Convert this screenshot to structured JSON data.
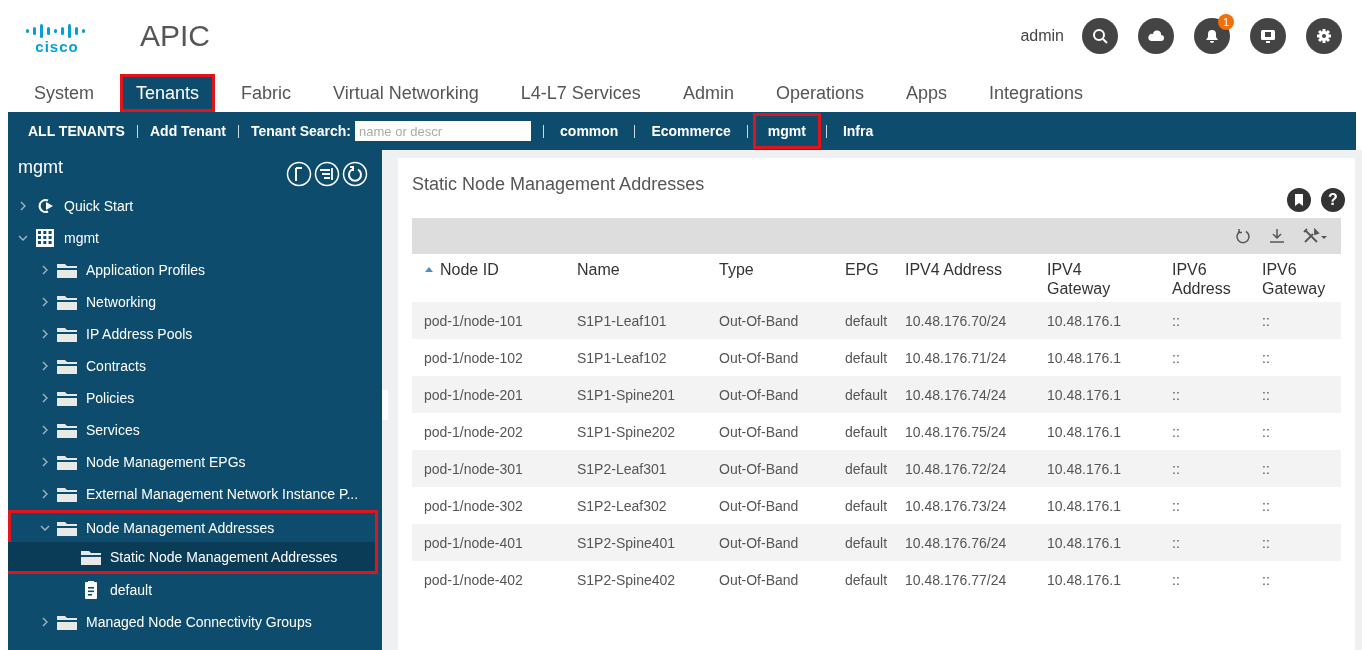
{
  "header": {
    "logo": "cisco",
    "app": "APIC",
    "user": "admin",
    "notifications_badge": "1"
  },
  "main_tabs": [
    {
      "label": "System",
      "selected": false,
      "highlighted": false
    },
    {
      "label": "Tenants",
      "selected": true,
      "highlighted": true
    },
    {
      "label": "Fabric",
      "selected": false,
      "highlighted": false
    },
    {
      "label": "Virtual Networking",
      "selected": false,
      "highlighted": false
    },
    {
      "label": "L4-L7 Services",
      "selected": false,
      "highlighted": false
    },
    {
      "label": "Admin",
      "selected": false,
      "highlighted": false
    },
    {
      "label": "Operations",
      "selected": false,
      "highlighted": false
    },
    {
      "label": "Apps",
      "selected": false,
      "highlighted": false
    },
    {
      "label": "Integrations",
      "selected": false,
      "highlighted": false
    }
  ],
  "tenant_bar": {
    "items": [
      {
        "label": "ALL TENANTS",
        "kind": "link"
      },
      {
        "label": "Add Tenant",
        "kind": "link"
      },
      {
        "label": "Tenant Search:",
        "kind": "search",
        "placeholder": "name or descr"
      }
    ],
    "recent": [
      {
        "label": "common",
        "highlighted": false
      },
      {
        "label": "Ecommerce",
        "highlighted": false
      },
      {
        "label": "mgmt",
        "highlighted": true
      },
      {
        "label": "Infra",
        "highlighted": false
      }
    ]
  },
  "sidebar": {
    "title": "mgmt",
    "tree": [
      {
        "label": "Quick Start",
        "kind": "quickstart",
        "expanded": false,
        "selected": false,
        "highlighted": false
      },
      {
        "label": "mgmt",
        "kind": "tenant",
        "expanded": true,
        "selected": false,
        "highlighted": false,
        "children": [
          {
            "label": "Application Profiles",
            "kind": "folder",
            "expanded": false,
            "selected": false,
            "highlighted": false
          },
          {
            "label": "Networking",
            "kind": "folder",
            "expanded": false,
            "selected": false,
            "highlighted": false
          },
          {
            "label": "IP Address Pools",
            "kind": "folder",
            "expanded": false,
            "selected": false,
            "highlighted": false
          },
          {
            "label": "Contracts",
            "kind": "folder",
            "expanded": false,
            "selected": false,
            "highlighted": false
          },
          {
            "label": "Policies",
            "kind": "folder",
            "expanded": false,
            "selected": false,
            "highlighted": false
          },
          {
            "label": "Services",
            "kind": "folder",
            "expanded": false,
            "selected": false,
            "highlighted": false
          },
          {
            "label": "Node Management EPGs",
            "kind": "folder",
            "expanded": false,
            "selected": false,
            "highlighted": false
          },
          {
            "label": "External Management Network Instance P...",
            "kind": "folder",
            "expanded": false,
            "selected": false,
            "highlighted": false
          },
          {
            "label": "Node Management Addresses",
            "kind": "folder",
            "expanded": true,
            "selected": false,
            "highlighted": true,
            "children": [
              {
                "label": "Static Node Management Addresses",
                "kind": "folder",
                "selected": true,
                "highlighted": true
              },
              {
                "label": "default",
                "kind": "policy",
                "selected": false,
                "highlighted": false
              }
            ]
          },
          {
            "label": "Managed Node Connectivity Groups",
            "kind": "folder",
            "expanded": false,
            "selected": false,
            "highlighted": false
          }
        ]
      }
    ]
  },
  "content": {
    "title": "Static Node Management Addresses",
    "help_button": "?",
    "table": {
      "columns": [
        {
          "label": "Node ID",
          "sorted": true
        },
        {
          "label": "Name",
          "sorted": false
        },
        {
          "label": "Type",
          "sorted": false
        },
        {
          "label": "EPG",
          "sorted": false
        },
        {
          "label": "IPV4 Address",
          "sorted": false
        },
        {
          "label": "IPV4 Gateway",
          "sorted": false
        },
        {
          "label": "IPV6 Address",
          "sorted": false
        },
        {
          "label": "IPV6 Gateway",
          "sorted": false
        }
      ],
      "rows": [
        [
          "pod-1/node-101",
          "S1P1-Leaf101",
          "Out-Of-Band",
          "default",
          "10.48.176.70/24",
          "10.48.176.1",
          "::",
          "::"
        ],
        [
          "pod-1/node-102",
          "S1P1-Leaf102",
          "Out-Of-Band",
          "default",
          "10.48.176.71/24",
          "10.48.176.1",
          "::",
          "::"
        ],
        [
          "pod-1/node-201",
          "S1P1-Spine201",
          "Out-Of-Band",
          "default",
          "10.48.176.74/24",
          "10.48.176.1",
          "::",
          "::"
        ],
        [
          "pod-1/node-202",
          "S1P1-Spine202",
          "Out-Of-Band",
          "default",
          "10.48.176.75/24",
          "10.48.176.1",
          "::",
          "::"
        ],
        [
          "pod-1/node-301",
          "S1P2-Leaf301",
          "Out-Of-Band",
          "default",
          "10.48.176.72/24",
          "10.48.176.1",
          "::",
          "::"
        ],
        [
          "pod-1/node-302",
          "S1P2-Leaf302",
          "Out-Of-Band",
          "default",
          "10.48.176.73/24",
          "10.48.176.1",
          "::",
          "::"
        ],
        [
          "pod-1/node-401",
          "S1P2-Spine401",
          "Out-Of-Band",
          "default",
          "10.48.176.76/24",
          "10.48.176.1",
          "::",
          "::"
        ],
        [
          "pod-1/node-402",
          "S1P2-Spine402",
          "Out-Of-Band",
          "default",
          "10.48.176.77/24",
          "10.48.176.1",
          "::",
          "::"
        ]
      ]
    }
  }
}
